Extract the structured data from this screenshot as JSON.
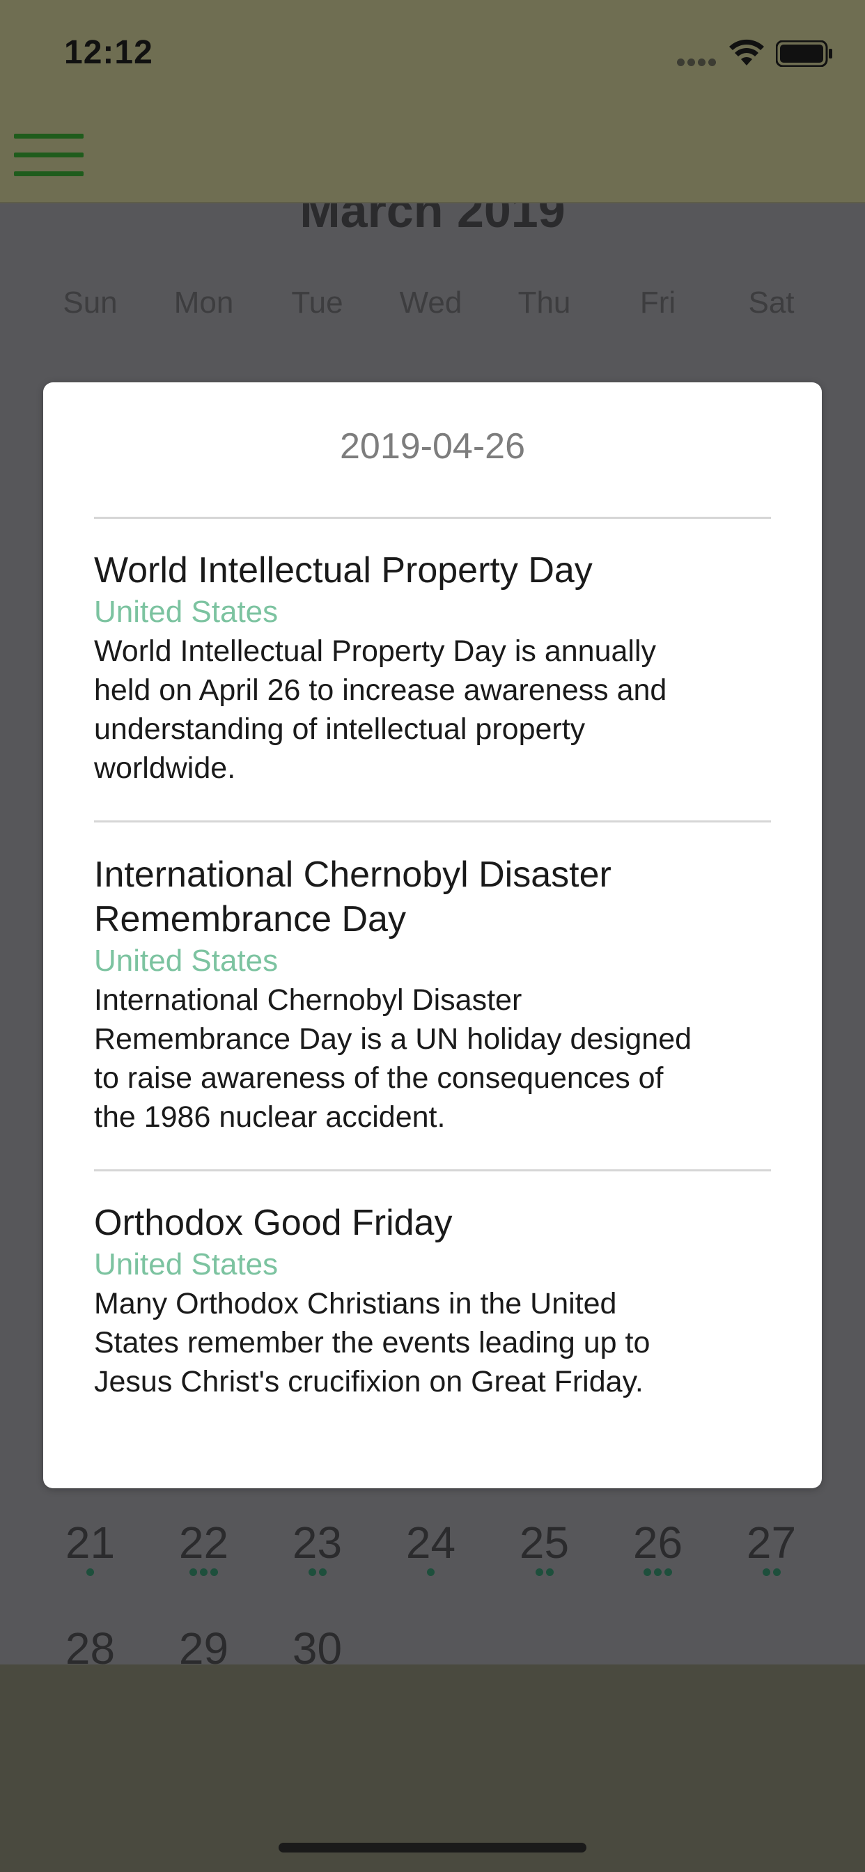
{
  "status_bar": {
    "time": "12:12"
  },
  "nav": {
    "menu_icon": "hamburger-menu-icon"
  },
  "calendar": {
    "month_title": "March 2019",
    "weekdays": [
      "Sun",
      "Mon",
      "Tue",
      "Wed",
      "Thu",
      "Fri",
      "Sat"
    ],
    "visible_weeks": [
      {
        "days": [
          {
            "day": "21",
            "dots": 1
          },
          {
            "day": "22",
            "dots": 3
          },
          {
            "day": "23",
            "dots": 2
          },
          {
            "day": "24",
            "dots": 1
          },
          {
            "day": "25",
            "dots": 2
          },
          {
            "day": "26",
            "dots": 3
          },
          {
            "day": "27",
            "dots": 2
          }
        ]
      },
      {
        "days": [
          {
            "day": "28",
            "dots": 0
          },
          {
            "day": "29",
            "dots": 0
          },
          {
            "day": "30",
            "dots": 0
          }
        ]
      }
    ]
  },
  "modal": {
    "date": "2019-04-26",
    "events": [
      {
        "title_lines": [
          "World Intellectual Property Day"
        ],
        "country": "United States",
        "description_lines": [
          "World Intellectual Property Day is annually",
          "held on April 26 to increase awareness and",
          "understanding of intellectual property",
          "worldwide."
        ]
      },
      {
        "title_lines": [
          "International Chernobyl Disaster",
          "Remembrance Day"
        ],
        "country": "United States",
        "description_lines": [
          "International Chernobyl Disaster",
          "Remembrance Day is a UN holiday designed",
          "to raise awareness of the consequences of",
          "the 1986 nuclear accident."
        ]
      },
      {
        "title_lines": [
          "Orthodox Good Friday"
        ],
        "country": "United States",
        "description_lines": [
          "Many Orthodox Christians in the United",
          "States remember the events leading up to",
          "Jesus Christ's crucifixion on Great Friday."
        ]
      }
    ]
  },
  "colors": {
    "country_accent": "#7cc3a0",
    "menu_icon": "#1f5c1c",
    "dot": "#1e4f3c"
  }
}
